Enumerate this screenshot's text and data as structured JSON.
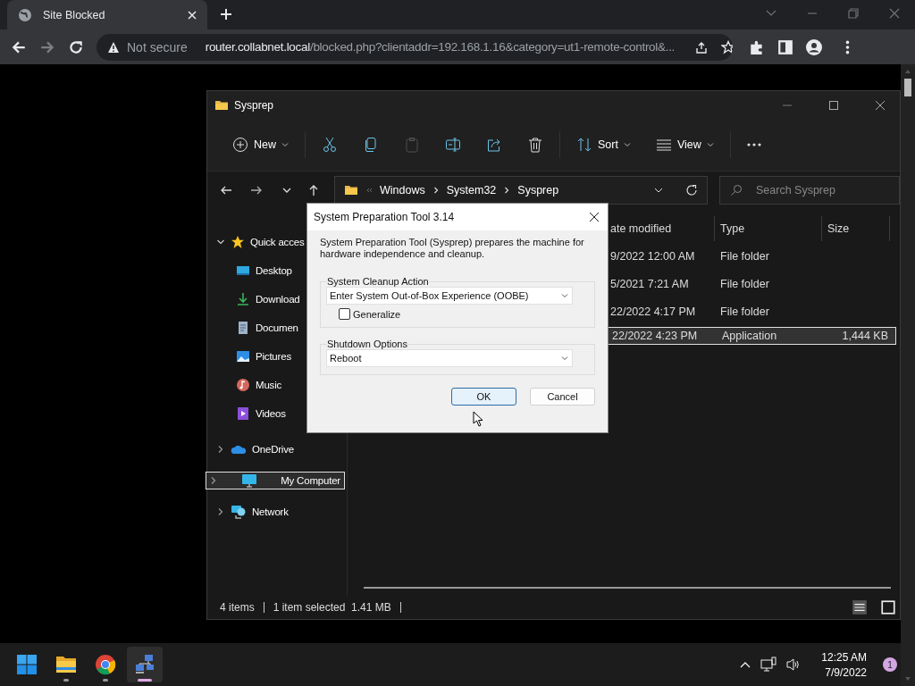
{
  "browser": {
    "tab": {
      "title": "Site Blocked"
    },
    "security": "Not secure",
    "url_host": "router.collabnet.local",
    "url_path": "/blocked.php?clientaddr=192.168.1.16&category=ut1-remote-control&..."
  },
  "explorer": {
    "title": "Sysprep",
    "toolbar": [
      {
        "kind": "new",
        "label": "New",
        "disabled": false
      },
      {
        "kind": "cut",
        "disabled": false
      },
      {
        "kind": "copy",
        "disabled": false
      },
      {
        "kind": "paste",
        "disabled": true
      },
      {
        "kind": "rename",
        "disabled": false
      },
      {
        "kind": "share",
        "disabled": false
      },
      {
        "kind": "delete",
        "disabled": false
      },
      {
        "kind": "sort",
        "label": "Sort",
        "disabled": false
      },
      {
        "kind": "view",
        "label": "View",
        "disabled": false
      },
      {
        "kind": "more",
        "disabled": false
      }
    ],
    "breadcrumbs": [
      "Windows",
      "System32",
      "Sysprep"
    ],
    "search": {
      "placeholder": "Search Sysprep"
    },
    "sidebar": [
      {
        "kind": "star",
        "label": "Quick acces",
        "expanded": true,
        "selected": false,
        "children": [
          {
            "kind": "desktop",
            "label": "Desktop",
            "selected": false
          },
          {
            "kind": "download",
            "label": "Download",
            "selected": false
          },
          {
            "kind": "document",
            "label": "Documen",
            "selected": false
          },
          {
            "kind": "pictures",
            "label": "Pictures",
            "selected": false
          },
          {
            "kind": "music",
            "label": "Music",
            "selected": false
          },
          {
            "kind": "videos",
            "label": "Videos",
            "selected": false
          }
        ]
      },
      {
        "kind": "cloud",
        "label": "OneDrive",
        "expanded": false,
        "selected": false
      },
      {
        "kind": "computer",
        "label": "My Computer",
        "expanded": false,
        "selected": true
      },
      {
        "kind": "network",
        "label": "Network",
        "expanded": false,
        "selected": false
      }
    ],
    "columns": [
      "ate modified",
      "Type",
      "Size"
    ],
    "rows": [
      {
        "date": "9/2022 12:00 AM",
        "type": "File folder",
        "size": "",
        "selected": false
      },
      {
        "date": "5/2021 7:21 AM",
        "type": "File folder",
        "size": "",
        "selected": false
      },
      {
        "date": "22/2022 4:17 PM",
        "type": "File folder",
        "size": "",
        "selected": false
      },
      {
        "date": "22/2022 4:23 PM",
        "type": "Application",
        "size": "1,444 KB",
        "selected": true
      }
    ],
    "status": {
      "count": "4 items",
      "selection": "1 item selected  1.41 MB"
    }
  },
  "dialog": {
    "title": "System Preparation Tool 3.14",
    "description": "System Preparation Tool (Sysprep) prepares the machine for hardware independence and cleanup.",
    "cleanup": {
      "label": "System Cleanup Action",
      "value": "Enter System Out-of-Box Experience (OOBE)",
      "generalize": {
        "label": "Generalize",
        "checked": false
      }
    },
    "shutdown": {
      "label": "Shutdown Options",
      "value": "Reboot"
    },
    "buttons": [
      {
        "label": "OK",
        "default": true
      },
      {
        "label": "Cancel",
        "default": false
      }
    ]
  },
  "taskbar": {
    "apps": [
      {
        "kind": "start",
        "running": false,
        "active": false
      },
      {
        "kind": "explorer",
        "running": true,
        "active": false
      },
      {
        "kind": "chrome",
        "running": true,
        "active": false
      },
      {
        "kind": "network",
        "running": true,
        "active": true
      }
    ],
    "time": "12:25 AM",
    "date": "7/9/2022",
    "notifications": "1"
  }
}
